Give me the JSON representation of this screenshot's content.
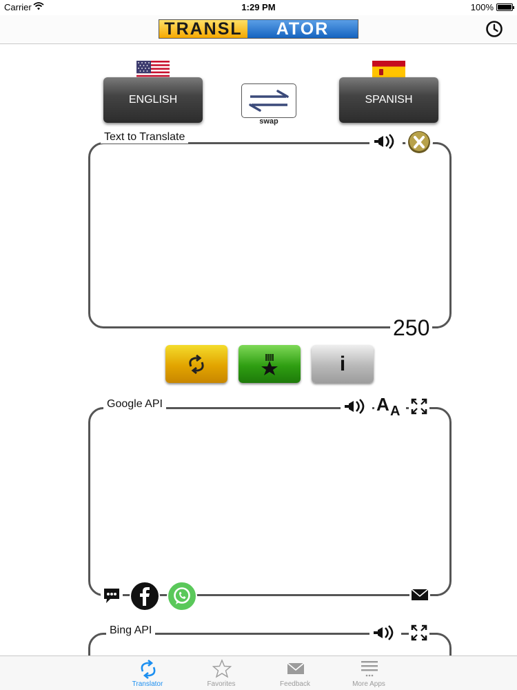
{
  "status_bar": {
    "carrier": "Carrier",
    "time": "1:29 PM",
    "battery": "100%"
  },
  "nav": {
    "logo_part1": "TRANSL",
    "logo_part2": "ATOR",
    "history_icon": "clock-icon"
  },
  "languages": {
    "source": "ENGLISH",
    "target": "SPANISH",
    "swap_label": "swap"
  },
  "input_box": {
    "label": "Text to Translate",
    "char_count": "250"
  },
  "google_box": {
    "label": "Google API"
  },
  "bing_box": {
    "label": "Bing API"
  },
  "tabs": [
    {
      "label": "Translator",
      "icon": "translator-icon",
      "active": true
    },
    {
      "label": "Favorites",
      "icon": "star-icon",
      "active": false
    },
    {
      "label": "Feedback",
      "icon": "envelope-icon",
      "active": false
    },
    {
      "label": "More Apps",
      "icon": "menu-icon",
      "active": false
    }
  ],
  "colors": {
    "accent": "#1c8ff0",
    "border": "#555555",
    "translate_btn": "#e2a400",
    "favorite_btn": "#2f9e12",
    "info_btn": "#b8b8b8"
  }
}
